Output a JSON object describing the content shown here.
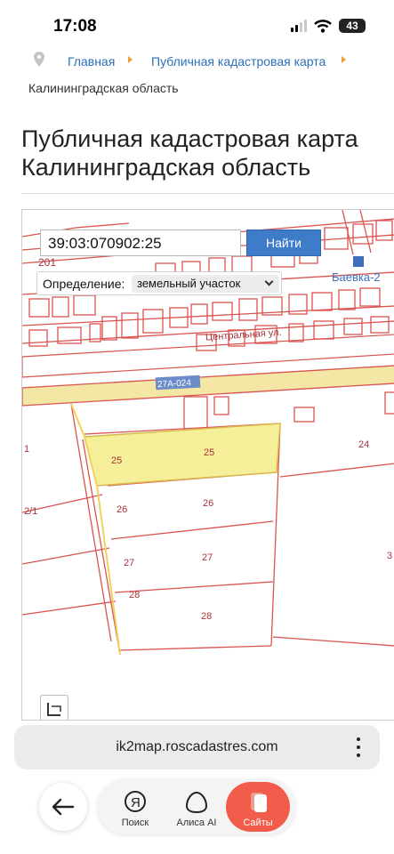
{
  "status_bar": {
    "time": "17:08",
    "battery": "43"
  },
  "breadcrumb": {
    "items": [
      "Главная",
      "Публичная кадастровая карта"
    ],
    "current": "Калининградская область"
  },
  "page": {
    "title": "Публичная кадастровая карта\nКалининградская область"
  },
  "map": {
    "search": {
      "value": "39:03:070902:25",
      "button": "Найти"
    },
    "definition": {
      "label": "Определение:",
      "selected": "земельный участок"
    },
    "labels": {
      "top_left": "201",
      "street": "Центральная ул.",
      "road": "27А-024",
      "stop": "Баевка-2",
      "p25a": "25",
      "p25b": "25",
      "p24": "24",
      "p26": "26",
      "p26b": "26",
      "p27": "27",
      "p27b": "27",
      "p28": "28",
      "p28b": "28",
      "left1": "1",
      "left21": "2/1",
      "right3": "3"
    },
    "colors": {
      "parcel_line": "#d9534f",
      "selected_fill": "#f6ef9a",
      "road_fill": "#f4e7a6"
    }
  },
  "browser": {
    "url": "ik2map.roscadastres.com"
  },
  "nav": {
    "tabs": [
      {
        "label": "Поиск",
        "icon": "yandex-search-icon"
      },
      {
        "label": "Алиса AI",
        "icon": "alice-icon"
      },
      {
        "label": "Сайты",
        "icon": "sites-icon"
      }
    ]
  }
}
